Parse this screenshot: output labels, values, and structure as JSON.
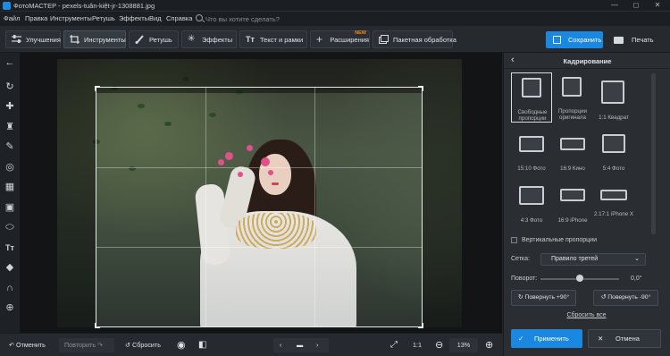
{
  "window": {
    "app_name": "ФотоМАСТЕР",
    "title": "ФотоМАСТЕР - pexels-tuân-kiệt-jr-1308881.jpg",
    "minimize": "—",
    "maximize": "◻",
    "close": "✕"
  },
  "menu": {
    "items": [
      "Файл",
      "Правка",
      "Инструменты",
      "Ретушь",
      "Эффекты",
      "Вид",
      "Справка"
    ],
    "search_placeholder": "Что вы хотите сделать?"
  },
  "toolbar": {
    "tabs": [
      {
        "label": "Улучшения",
        "icon": "sliders-icon"
      },
      {
        "label": "Инструменты",
        "icon": "crop-icon",
        "active": true
      },
      {
        "label": "Ретушь",
        "icon": "brush-icon"
      },
      {
        "label": "Эффекты",
        "icon": "sparkles-icon"
      },
      {
        "label": "Текст и рамки",
        "icon": "text-icon"
      },
      {
        "label": "Расширения",
        "icon": "plus-icon",
        "badge": "NEW"
      },
      {
        "label": "Пакетная обработка",
        "icon": "batch-icon"
      }
    ],
    "save_label": "Сохранить",
    "print_label": "Печать"
  },
  "left_tools": [
    "back-arrow-icon",
    "rotate-icon",
    "bandage-icon",
    "stamp-icon",
    "brush-icon",
    "radial-icon",
    "gradient-filter-icon",
    "vignette-icon",
    "tilt-shift-icon",
    "text-icon",
    "fill-icon",
    "magnet-icon",
    "globe-icon"
  ],
  "panel": {
    "title": "Кадрирование",
    "presets": [
      {
        "label": "Свободные пропорции",
        "selected": true
      },
      {
        "label": "Пропорции оригинала"
      },
      {
        "label": "1:1 Квадрат"
      },
      {
        "label": "15:10 Фото"
      },
      {
        "label": "16:9 Кино"
      },
      {
        "label": "5:4 Фото"
      },
      {
        "label": "4:3 Фото"
      },
      {
        "label": "16:9 iPhone"
      },
      {
        "label": "2.17:1 iPhone X"
      }
    ],
    "vertical_label": "Вертикальные пропорции",
    "vertical_checked": false,
    "grid_label": "Сетка:",
    "grid_value": "Правило третей",
    "rotation_label": "Поворот:",
    "rotation_value": "0,0°",
    "rotate_plus": "Повернуть +90°",
    "rotate_minus": "Повернуть -90°",
    "reset_all": "Сбросить все",
    "apply": "Применить",
    "cancel": "Отмена"
  },
  "bottom": {
    "undo": "Отменить",
    "redo": "Повторить",
    "reset": "Сбросить",
    "actual_size": "1:1",
    "zoom": "13%"
  },
  "colors": {
    "accent": "#1a88e0",
    "new_badge": "#f08a1c"
  }
}
